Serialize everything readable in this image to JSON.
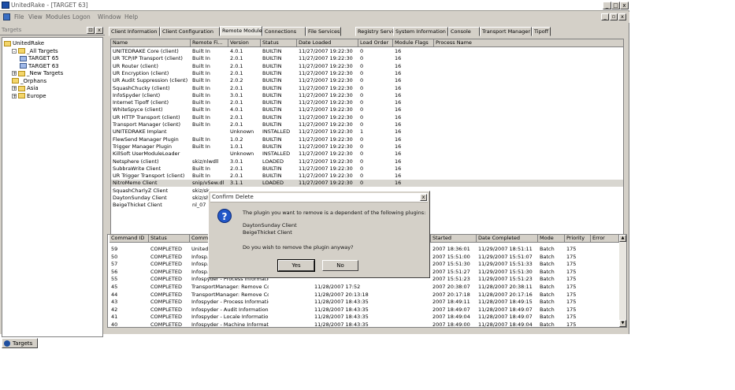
{
  "window": {
    "title": "UnitedRake - [TARGET 63]",
    "min": "_",
    "max": "□",
    "close": "x"
  },
  "menubar": {
    "items": [
      "File",
      "View",
      "Modules",
      "Logon",
      "Window",
      "Help"
    ],
    "mdi": [
      "_",
      "▫",
      "x"
    ]
  },
  "leftpane": {
    "header": "Targets",
    "tree": [
      {
        "label": "UnitedRake",
        "level": 0,
        "kind": "root"
      },
      {
        "label": "_All Targets",
        "level": 1,
        "kind": "folder",
        "toggle": "-"
      },
      {
        "label": "TARGET 65",
        "level": 2,
        "kind": "computer"
      },
      {
        "label": "TARGET 63",
        "level": 2,
        "kind": "computer"
      },
      {
        "label": "_New Targets",
        "level": 1,
        "kind": "folder",
        "toggle": "+"
      },
      {
        "label": "_Orphans",
        "level": 1,
        "kind": "folder",
        "toggle": ""
      },
      {
        "label": "Asia",
        "level": 1,
        "kind": "folder",
        "toggle": "+"
      },
      {
        "label": "Europe",
        "level": 1,
        "kind": "folder",
        "toggle": "+"
      }
    ],
    "tab_label": "Targets"
  },
  "tabs": [
    "Client Information",
    "Client Configuration",
    "Remote Modules",
    "Connections",
    "File Services",
    "Registry Services",
    "System Information",
    "Console",
    "Transport Manager",
    "Tipoff"
  ],
  "active_tab": "Remote Modules",
  "modules_table": {
    "columns": [
      "Name",
      "Remote Fi...",
      "Version",
      "Status",
      "Date Loaded",
      "Load Order",
      "Module Flags",
      "Process Name"
    ],
    "rows": [
      [
        "UNITEDRAKE Core (client)",
        "Built In",
        "4.0.1",
        "BUILTIN",
        "11/27/2007 19:22:30",
        "0",
        "16",
        ""
      ],
      [
        "UR TCP/IP Transport (client)",
        "Built In",
        "2.0.1",
        "BUILTIN",
        "11/27/2007 19:22:30",
        "0",
        "16",
        ""
      ],
      [
        "UR Router (client)",
        "Built In",
        "2.0.1",
        "BUILTIN",
        "11/27/2007 19:22:30",
        "0",
        "16",
        ""
      ],
      [
        "UR Encryption (client)",
        "Built In",
        "2.0.1",
        "BUILTIN",
        "11/27/2007 19:22:30",
        "0",
        "16",
        ""
      ],
      [
        "UR Audit Suppression (client)",
        "Built In",
        "2.0.2",
        "BUILTIN",
        "11/27/2007 19:22:30",
        "0",
        "16",
        ""
      ],
      [
        "SquashChucky (client)",
        "Built In",
        "2.0.1",
        "BUILTIN",
        "11/27/2007 19:22:30",
        "0",
        "16",
        ""
      ],
      [
        "InfoSpyder (client)",
        "Built In",
        "3.0.1",
        "BUILTIN",
        "11/27/2007 19:22:30",
        "0",
        "16",
        ""
      ],
      [
        "Internet Tipoff (client)",
        "Built In",
        "2.0.1",
        "BUILTIN",
        "11/27/2007 19:22:30",
        "0",
        "16",
        ""
      ],
      [
        "WhiteSpyce (client)",
        "Built In",
        "4.0.1",
        "BUILTIN",
        "11/27/2007 19:22:30",
        "0",
        "16",
        ""
      ],
      [
        "UR HTTP Transport (client)",
        "Built In",
        "2.0.1",
        "BUILTIN",
        "11/27/2007 19:22:30",
        "0",
        "16",
        ""
      ],
      [
        "Transport Manager (client)",
        "Built In",
        "2.0.1",
        "BUILTIN",
        "11/27/2007 19:22:30",
        "0",
        "16",
        ""
      ],
      [
        "UNITEDRAKE Implant",
        "",
        "Unknown",
        "INSTALLED",
        "11/27/2007 19:22:30",
        "1",
        "16",
        ""
      ],
      [
        "FlewSend Manager Plugin",
        "Built In",
        "1.0.2",
        "BUILTIN",
        "11/27/2007 19:22:30",
        "0",
        "16",
        ""
      ],
      [
        "Trigger Manager Plugin",
        "Built In",
        "1.0.1",
        "BUILTIN",
        "11/27/2007 19:22:30",
        "0",
        "16",
        ""
      ],
      [
        "KillSoft UserModuleLoader",
        "",
        "Unknown",
        "INSTALLED",
        "11/27/2007 19:22:30",
        "0",
        "16",
        ""
      ],
      [
        "Netsphere (client)",
        "skiz/nlwdll",
        "3.0.1",
        "LOADED",
        "11/27/2007 19:22:30",
        "0",
        "16",
        ""
      ],
      [
        "SubbraWrite Client",
        "Built In",
        "2.0.1",
        "BUILTIN",
        "11/27/2007 19:22:30",
        "0",
        "16",
        ""
      ],
      [
        "UR Trigger Transport (client)",
        "Built In",
        "2.0.1",
        "BUILTIN",
        "11/27/2007 19:22:30",
        "0",
        "16",
        ""
      ],
      [
        "NitroMemo Client",
        "snip/vSew.dl",
        "3.1.1",
        "LOADED",
        "11/27/2007 19:22:30",
        "0",
        "16",
        ""
      ],
      [
        "SquashCharlyZ Client",
        "skiz/sk",
        "",
        "",
        "",
        "",
        "",
        ""
      ],
      [
        "DaytonSunday Client",
        "skiz/sh",
        "",
        "",
        "",
        "",
        "",
        ""
      ],
      [
        "BeigeThicket Client",
        "nl_07",
        "",
        "",
        "",
        "",
        "",
        ""
      ]
    ],
    "selected_row": 18
  },
  "commands_table": {
    "columns": [
      "Command ID",
      "Status",
      "Command",
      "",
      "",
      "Started",
      "Date Completed",
      "Mode",
      "Priority",
      "Error"
    ],
    "rows": [
      [
        "59",
        "COMPLETED",
        "United...",
        "",
        "",
        "2007 18:36:01",
        "11/29/2007 18:51:11",
        "Batch",
        "175",
        ""
      ],
      [
        "50",
        "COMPLETED",
        "Infosp...",
        "",
        "",
        "2007 15:51:00",
        "11/29/2007 15:51:07",
        "Batch",
        "175",
        ""
      ],
      [
        "57",
        "COMPLETED",
        "Infosp...",
        "",
        "",
        "2007 15:51:30",
        "11/29/2007 15:51:33",
        "Batch",
        "175",
        ""
      ],
      [
        "56",
        "COMPLETED",
        "Infosp...",
        "",
        "",
        "2007 15:51:27",
        "11/29/2007 15:51:30",
        "Batch",
        "175",
        ""
      ],
      [
        "55",
        "COMPLETED",
        "Infospyder - Process Information",
        "",
        "",
        "2007 15:51:23",
        "11/29/2007 15:51:23",
        "Batch",
        "175",
        ""
      ],
      [
        "45",
        "COMPLETED",
        "TransportManager: Remove Config",
        "",
        "11/28/2007 17:52",
        "2007 20:38:07",
        "11/28/2007 20:38:11",
        "Batch",
        "175",
        ""
      ],
      [
        "44",
        "COMPLETED",
        "TransportManager: Remove Config",
        "",
        "11/28/2007 20:13:18",
        "2007 20:17:18",
        "11/28/2007 20:17:16",
        "Batch",
        "175",
        ""
      ],
      [
        "43",
        "COMPLETED",
        "Infospyder - Process Information",
        "",
        "11/28/2007 18:43:35",
        "2007 18:49:11",
        "11/28/2007 18:49:15",
        "Batch",
        "175",
        ""
      ],
      [
        "42",
        "COMPLETED",
        "Infospyder - Audit Information",
        "",
        "11/28/2007 18:43:35",
        "2007 18:49:07",
        "11/28/2007 18:49:07",
        "Batch",
        "175",
        ""
      ],
      [
        "41",
        "COMPLETED",
        "Infospyder - Locale Information",
        "",
        "11/28/2007 18:43:35",
        "2007 18:49:04",
        "11/28/2007 18:49:07",
        "Batch",
        "175",
        ""
      ],
      [
        "40",
        "COMPLETED",
        "Infospyder - Machine Information",
        "",
        "11/28/2007 18:43:35",
        "2007 18:49:00",
        "11/28/2007 18:49:04",
        "Batch",
        "175",
        ""
      ]
    ]
  },
  "dialog": {
    "title": "Confirm Delete",
    "close": "x",
    "message": "The plugin you want to remove is a dependent of the following plugins:",
    "deps": [
      "DaytonSunday Client",
      "BeigeThicket Client"
    ],
    "question": "Do you wish to remove the plugin anyway?",
    "yes": "Yes",
    "no": "No"
  }
}
